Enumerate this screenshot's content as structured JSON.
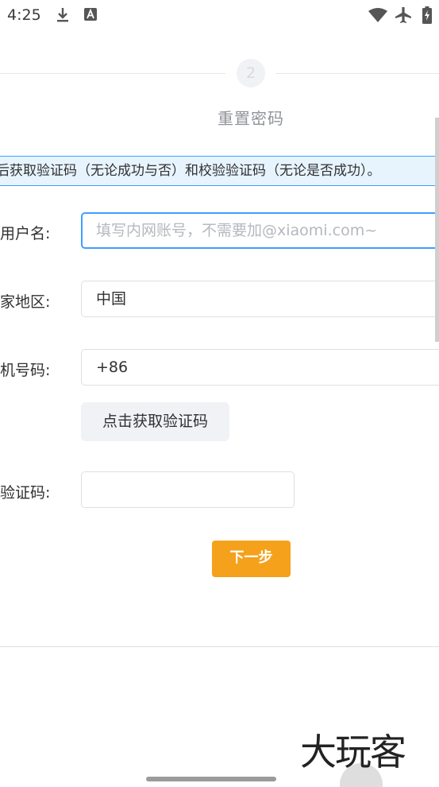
{
  "status_bar": {
    "time": "4:25",
    "icons": [
      "download-icon",
      "a-icon",
      "wifi-icon",
      "airplane-icon",
      "battery-icon"
    ]
  },
  "steps": {
    "current_number": "2",
    "current_title": "重置密码"
  },
  "alert": {
    "text": "后获取验证码（无论成功与否）和校验验证码（无论是否成功）。",
    "color": "#409eff"
  },
  "form": {
    "username": {
      "label": "用户名:",
      "placeholder": "填写内网账号，不需要加@xiaomi.com~"
    },
    "region": {
      "label": "家地区:",
      "value": "中国"
    },
    "phone": {
      "label": "机号码:",
      "value": "+86"
    },
    "get_code_label": "点击获取验证码",
    "code": {
      "label": "验证码:",
      "value": ""
    },
    "next_label": "下一步"
  },
  "colors": {
    "accent": "#f5a11b",
    "primary": "#409eff"
  },
  "watermark": "大玩客"
}
